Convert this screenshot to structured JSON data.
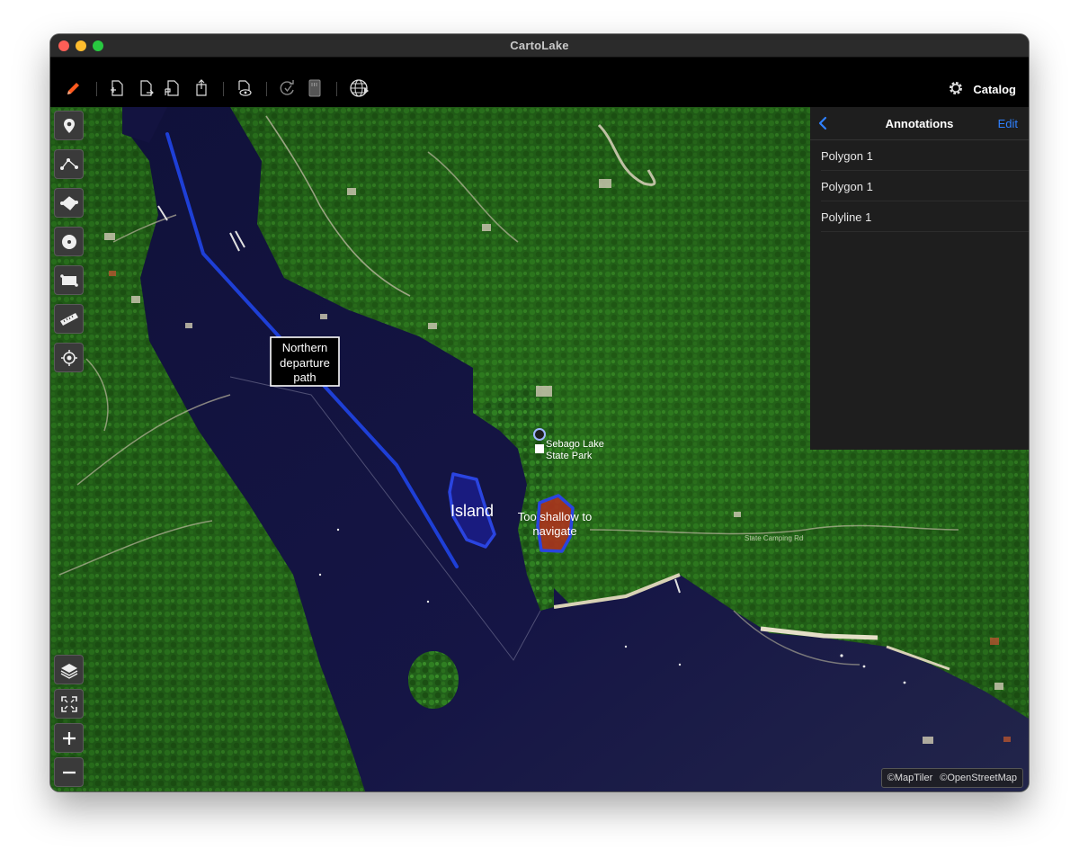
{
  "window": {
    "title": "CartoLake"
  },
  "toolbar": {
    "catalog_label": "Catalog"
  },
  "panel": {
    "title": "Annotations",
    "edit_label": "Edit",
    "items": [
      {
        "label": "Polygon 1"
      },
      {
        "label": "Polygon 1"
      },
      {
        "label": "Polyline 1"
      }
    ]
  },
  "map": {
    "labels": {
      "path_note_line1": "Northern",
      "path_note_line2": "departure",
      "path_note_line3": "path",
      "island": "Island",
      "shallow_line1": "Too shallow to",
      "shallow_line2": "navigate",
      "poi_line1": "Sebago Lake",
      "poi_line2": "State Park",
      "road_label": "State Camping Rd"
    },
    "attribution": {
      "maptiler": "©MapTiler",
      "osm": "©OpenStreetMap"
    }
  },
  "colors": {
    "accent": "#ff5a1f",
    "polyline": "#1e3fd6",
    "island_fill": "#1a1c8a",
    "shallow_fill": "#b3301d",
    "panel_bg": "#1e1e1e",
    "link": "#2f80ff"
  },
  "icons": {
    "toolbar": [
      "pencil-icon",
      "add-doc-icon",
      "doc-next-icon",
      "doc-flag-icon",
      "share-doc-icon",
      "view-doc-icon",
      "refresh-check-icon",
      "sd-card-icon",
      "globe-icon",
      "gear-icon"
    ],
    "map_tools": [
      "pin-icon",
      "polyline-icon",
      "polygon-icon",
      "circle-icon",
      "rectangle-icon",
      "ruler-icon",
      "locate-icon",
      "layers-icon",
      "fit-icon",
      "zoom-in-icon",
      "zoom-out-icon"
    ]
  }
}
